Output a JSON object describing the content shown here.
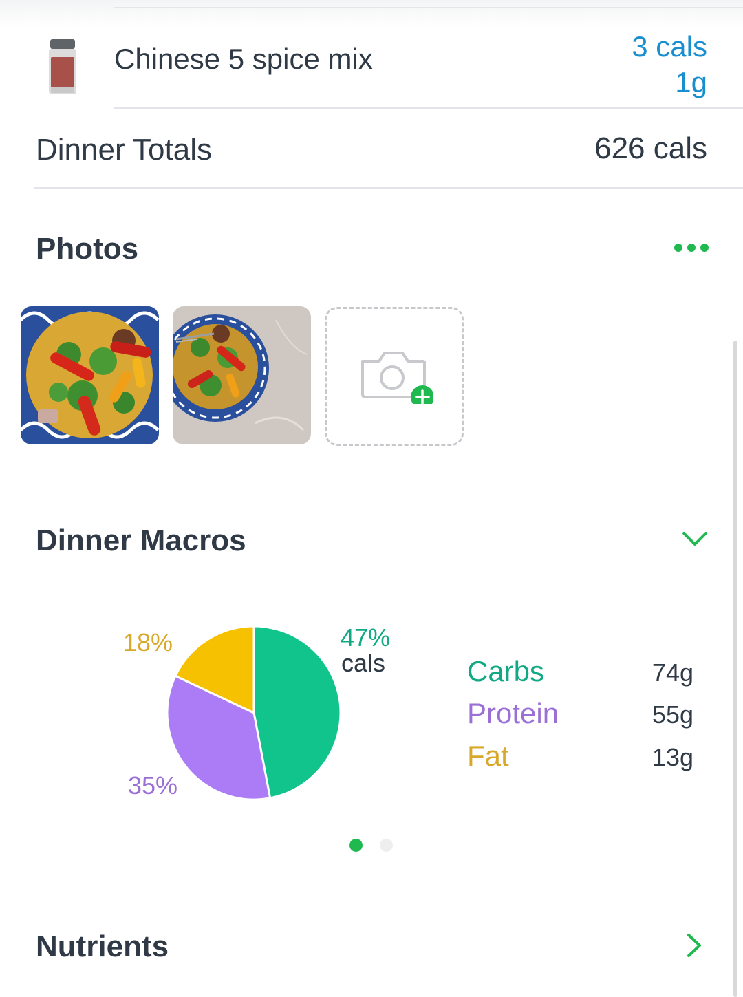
{
  "food_item": {
    "icon": "spice-jar-icon",
    "name": "Chinese 5 spice mix",
    "cals": "3 cals",
    "grams": "1g"
  },
  "totals": {
    "label": "Dinner Totals",
    "value": "626 cals"
  },
  "photos": {
    "title": "Photos",
    "more_icon": "more-dots-icon",
    "add_icon": "camera-add-icon"
  },
  "macros": {
    "title": "Dinner Macros",
    "toggle_icon": "chevron-down-icon",
    "carbs_pct_value": "47%",
    "carbs_pct_unit": "cals",
    "fat_pct": "18%",
    "protein_pct": "35%",
    "legend": [
      {
        "label": "Carbs",
        "value": "74g"
      },
      {
        "label": "Protein",
        "value": "55g"
      },
      {
        "label": "Fat",
        "value": "13g"
      }
    ],
    "pager": {
      "count": 2,
      "active": 1
    }
  },
  "nutrients": {
    "title": "Nutrients",
    "icon": "chevron-right-icon"
  },
  "colors": {
    "accent_green": "#1fb950",
    "carbs": "#10c48c",
    "protein": "#ab7cf5",
    "fat": "#f6c100",
    "link_blue": "#1a8fd0",
    "text_dark": "#2f3a46"
  },
  "chart_data": {
    "type": "pie",
    "title": "",
    "series": [
      {
        "name": "Carbs",
        "value": 47,
        "color": "#10c48c"
      },
      {
        "name": "Protein",
        "value": 35,
        "color": "#ab7cf5"
      },
      {
        "name": "Fat",
        "value": 18,
        "color": "#f6c100"
      }
    ]
  }
}
